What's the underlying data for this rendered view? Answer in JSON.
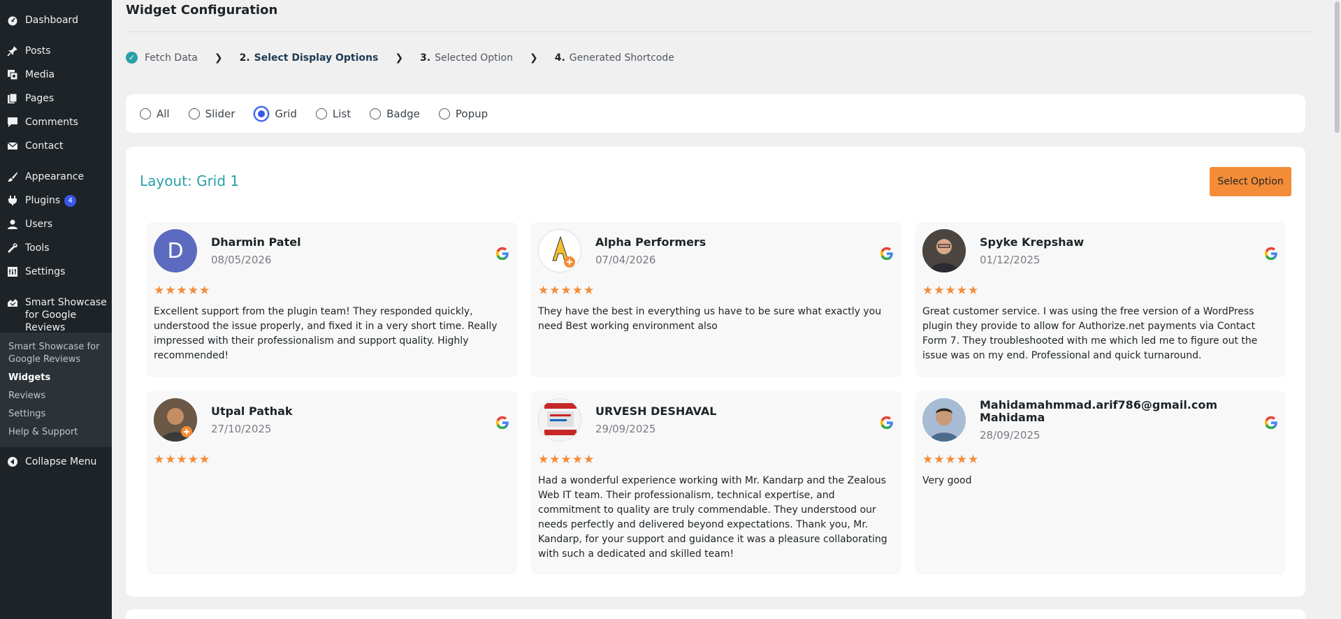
{
  "sidebar": {
    "items": [
      {
        "label": "Dashboard",
        "icon": "dashboard-icon"
      },
      {
        "label": "Posts",
        "icon": "pin-icon"
      },
      {
        "label": "Media",
        "icon": "media-icon"
      },
      {
        "label": "Pages",
        "icon": "pages-icon"
      },
      {
        "label": "Comments",
        "icon": "comment-icon"
      },
      {
        "label": "Contact",
        "icon": "mail-icon"
      },
      {
        "label": "Appearance",
        "icon": "brush-icon"
      },
      {
        "label": "Plugins",
        "icon": "plugin-icon",
        "badge": "4"
      },
      {
        "label": "Users",
        "icon": "user-icon"
      },
      {
        "label": "Tools",
        "icon": "wrench-icon"
      },
      {
        "label": "Settings",
        "icon": "settings-icon"
      },
      {
        "label": "Smart Showcase for Google Reviews",
        "icon": "showcase-icon"
      }
    ],
    "submenu": [
      {
        "label": "Smart Showcase for Google Reviews"
      },
      {
        "label": "Widgets"
      },
      {
        "label": "Reviews"
      },
      {
        "label": "Settings"
      },
      {
        "label": "Help & Support"
      }
    ],
    "collapse_label": "Collapse Menu"
  },
  "page": {
    "title": "Widget Configuration"
  },
  "steps": [
    {
      "num": "",
      "label": "Fetch Data"
    },
    {
      "num": "2.",
      "label": "Select Display Options"
    },
    {
      "num": "3.",
      "label": "Selected Option"
    },
    {
      "num": "4.",
      "label": "Generated Shortcode"
    }
  ],
  "filters": [
    {
      "label": "All"
    },
    {
      "label": "Slider"
    },
    {
      "label": "Grid"
    },
    {
      "label": "List"
    },
    {
      "label": "Badge"
    },
    {
      "label": "Popup"
    }
  ],
  "layout": {
    "title": "Layout: Grid 1",
    "select_label": "Select Option"
  },
  "reviews": [
    {
      "name": "Dharmin Patel",
      "date": "08/05/2026",
      "initial": "D",
      "stars": "★★★★★",
      "text": "Excellent support from the plugin team! They responded quickly, understood the issue properly, and fixed it in a very short time. Really impressed with their professionalism and support quality. Highly recommended!"
    },
    {
      "name": "Alpha Performers",
      "date": "07/04/2026",
      "initial": "",
      "stars": "★★★★★",
      "text": "They have the best in everything us have to be sure what exactly you need Best working environment also"
    },
    {
      "name": "Spyke Krepshaw",
      "date": "01/12/2025",
      "initial": "",
      "stars": "★★★★★",
      "text": "Great customer service. I was using the free version of a WordPress plugin they provide to allow for Authorize.net payments via Contact Form 7. They troubleshooted with me which led me to figure out the issue was on my end. Professional and quick turnaround."
    },
    {
      "name": "Utpal Pathak",
      "date": "27/10/2025",
      "initial": "",
      "stars": "★★★★★",
      "text": ""
    },
    {
      "name": "URVESH DESHAVAL",
      "date": "29/09/2025",
      "initial": "",
      "stars": "★★★★★",
      "text": "Had a wonderful experience working with Mr. Kandarp and the Zealous Web IT team. Their professionalism, technical expertise, and commitment to quality are truly commendable. They understood our needs perfectly and delivered beyond expectations. Thank you, Mr. Kandarp, for your support and guidance it was a pleasure collaborating with such a dedicated and skilled team!"
    },
    {
      "name": "Mahidamahmmad.arif786@gmail.com Mahidama",
      "date": "28/09/2025",
      "initial": "",
      "stars": "★★★★★",
      "text": "Very good"
    }
  ],
  "colors": {
    "sidebar_bg": "#1d2327",
    "accent_teal": "#2a9fa8",
    "button_orange": "#f48c38",
    "radio_blue": "#3858e9"
  }
}
